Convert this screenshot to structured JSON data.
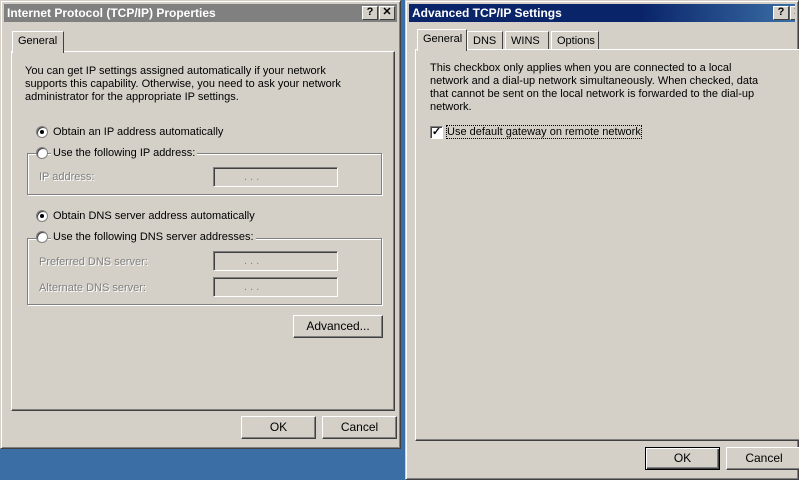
{
  "left_window": {
    "title": "Internet Protocol (TCP/IP) Properties",
    "help_btn": "?",
    "close_btn": "✕",
    "tab_general": "General",
    "intro": "You can get IP settings assigned automatically if your network supports this capability. Otherwise, you need to ask your network administrator for the appropriate IP settings.",
    "radio_obtain_ip": "Obtain an IP address automatically",
    "radio_use_ip": "Use the following IP address:",
    "ip_address_label": "IP address:",
    "radio_obtain_dns": "Obtain DNS server address automatically",
    "radio_use_dns": "Use the following DNS server addresses:",
    "preferred_dns_label": "Preferred DNS server:",
    "alternate_dns_label": "Alternate DNS server:",
    "ip_dots": ".      .      .",
    "advanced_btn": "Advanced...",
    "ok_btn": "OK",
    "cancel_btn": "Cancel"
  },
  "right_window": {
    "title": "Advanced TCP/IP Settings",
    "help_btn": "?",
    "close_btn": "✕",
    "tabs": [
      "General",
      "DNS",
      "WINS",
      "Options"
    ],
    "description": "This checkbox only applies when you are connected to a local network and a dial-up network simultaneously.  When checked, data that cannot be sent on the local network is forwarded to the dial-up network.",
    "checkbox_label": "Use default gateway on remote network",
    "checkbox_checked": "✓",
    "ok_btn": "OK",
    "cancel_btn": "Cancel"
  }
}
